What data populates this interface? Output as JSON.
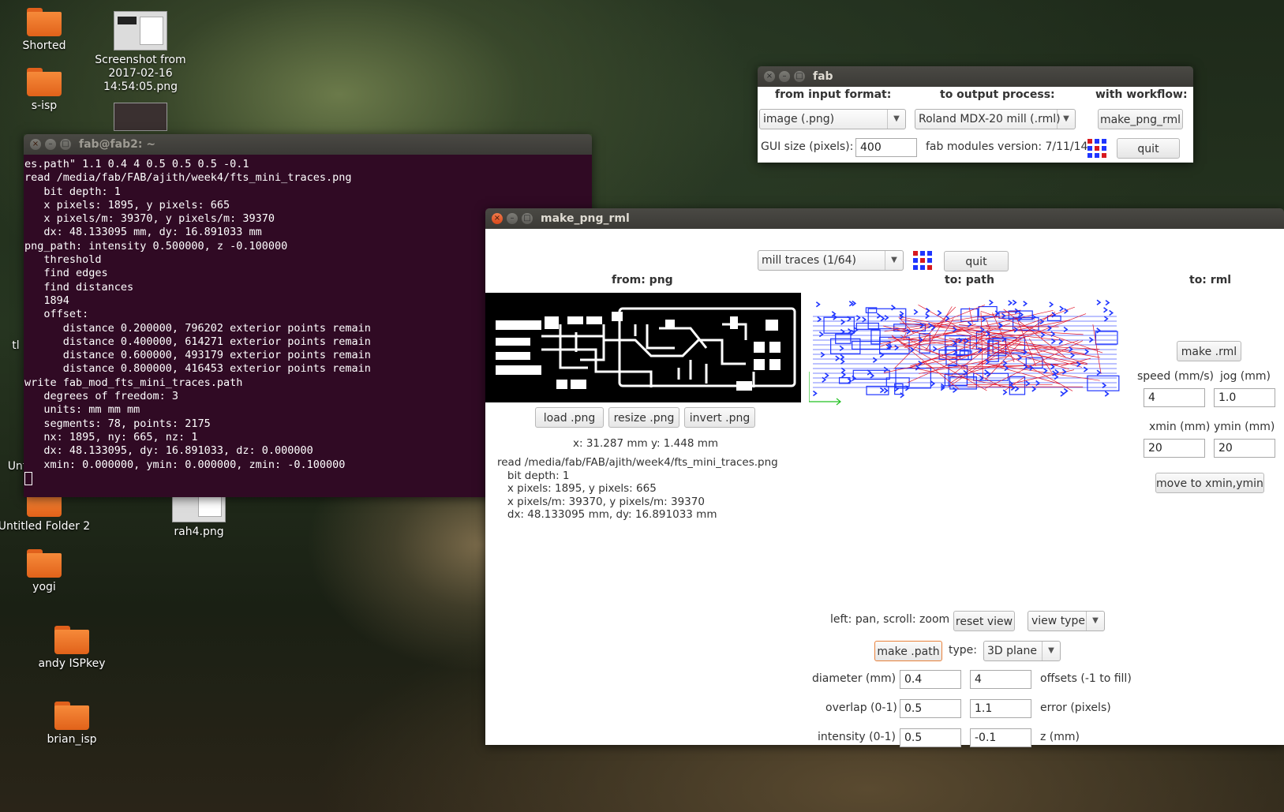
{
  "desktop": {
    "icons": [
      {
        "label": "Shorted"
      },
      {
        "label": "s-isp"
      },
      {
        "label": "Screenshot from 2017-02-16 14:54:05.png"
      },
      {
        "label": "Untitled Folder 2"
      },
      {
        "label": "rah4.png"
      },
      {
        "label": "yogi"
      },
      {
        "label": "andy ISPkey"
      },
      {
        "label": "brian_isp"
      }
    ],
    "partial_labels": [
      "tl",
      "Unt"
    ]
  },
  "terminal": {
    "title": "fab@fab2: ~",
    "lines": [
      "es.path\" 1.1 0.4 4 0.5 0.5 0.5 -0.1",
      "read /media/fab/FAB/ajith/week4/fts_mini_traces.png",
      "   bit depth: 1",
      "   x pixels: 1895, y pixels: 665",
      "   x pixels/m: 39370, y pixels/m: 39370",
      "   dx: 48.133095 mm, dy: 16.891033 mm",
      "png_path: intensity 0.500000, z -0.100000",
      "   threshold",
      "   find edges",
      "   find distances",
      "   1894",
      "   offset:",
      "      distance 0.200000, 796202 exterior points remain",
      "      distance 0.400000, 614271 exterior points remain",
      "      distance 0.600000, 493179 exterior points remain",
      "      distance 0.800000, 416453 exterior points remain",
      "write fab_mod_fts_mini_traces.path",
      "   degrees of freedom: 3",
      "   units: mm mm mm",
      "   segments: 78, points: 2175",
      "   nx: 1895, ny: 665, nz: 1",
      "   dx: 48.133095, dy: 16.891033, dz: 0.000000",
      "   xmin: 0.000000, ymin: 0.000000, zmin: -0.100000"
    ]
  },
  "fab": {
    "title": "fab",
    "input_format_label": "from input format:",
    "output_process_label": "to output process:",
    "workflow_label": "with workflow:",
    "input_format": "image (.png)",
    "output_process": "Roland MDX-20 mill (.rml)",
    "workflow_button": "make_png_rml",
    "gui_size_label": "GUI size (pixels):",
    "gui_size": "400",
    "version": "fab modules version: 7/11/14",
    "quit": "quit"
  },
  "make": {
    "title": "make_png_rml",
    "process": "mill traces (1/64)",
    "quit": "quit",
    "from_png": "from: png",
    "to_path": "to: path",
    "to_rml": "to: rml",
    "load_png": "load .png",
    "resize_png": "resize .png",
    "invert_png": "invert .png",
    "coords": "x: 31.287 mm  y: 1.448 mm",
    "info": "read /media/fab/FAB/ajith/week4/fts_mini_traces.png\n   bit depth: 1\n   x pixels: 1895, y pixels: 665\n   x pixels/m: 39370, y pixels/m: 39370\n   dx: 48.133095 mm, dy: 16.891033 mm",
    "pan_help": "left: pan, scroll: zoom",
    "reset_view": "reset view",
    "view_type": "view type",
    "make_path": "make .path",
    "type_label": "type:",
    "type_value": "3D plane",
    "diameter_label": "diameter (mm)",
    "diameter": "0.4",
    "offsets": "4",
    "offsets_label": "offsets (-1 to fill)",
    "overlap_label": "overlap (0-1)",
    "overlap": "0.5",
    "error": "1.1",
    "error_label": "error (pixels)",
    "intensity_label": "intensity (0-1)",
    "intensity": "0.5",
    "z": "-0.1",
    "z_label": "z (mm)",
    "make_rml": "make .rml",
    "speed_label": "speed (mm/s)",
    "jog_label": "jog (mm)",
    "speed": "4",
    "jog": "1.0",
    "xmin_label": "xmin (mm)",
    "ymin_label": "ymin (mm)",
    "xmin": "20",
    "ymin": "20",
    "move_button": "move to xmin,ymin"
  },
  "colors": {
    "terminal_bg": "#300a24",
    "path_blue": "#1f35ff",
    "path_red": "#e0142a",
    "highlight": "#e9823c"
  }
}
